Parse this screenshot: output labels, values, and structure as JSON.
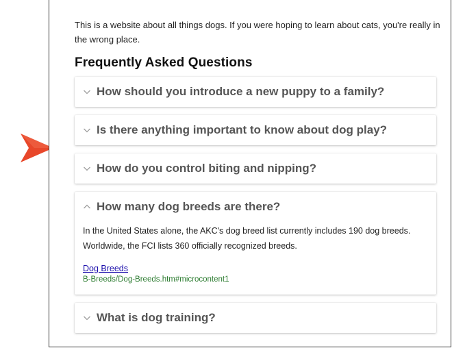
{
  "intro": "This is a website about all things dogs. If you were hoping to learn about cats, you're really in the wrong place.",
  "faq": {
    "heading": "Frequently Asked Questions",
    "items": [
      {
        "question": "How should you introduce a new puppy to a family?",
        "expanded": false
      },
      {
        "question": "Is there anything important to know about dog play?",
        "expanded": false
      },
      {
        "question": "How do you control biting and nipping?",
        "expanded": false
      },
      {
        "question": "How many dog breeds are there?",
        "expanded": true,
        "answer": "In the United States alone, the AKC's dog breed list currently includes 190 dog breeds. Worldwide, the FCI lists 360 officially recognized breeds.",
        "link_label": "Dog Breeds",
        "link_path": "B-Breeds/Dog-Breeds.htm#microcontent1"
      },
      {
        "question": "What is dog training?",
        "expanded": false
      }
    ]
  },
  "colors": {
    "pointer": "#e8472a",
    "question_text": "#555555",
    "link": "#1a0dab",
    "path": "#2e7d32"
  },
  "icons": {
    "pointer": "callout-arrow-icon",
    "collapsed": "chevron-down-icon",
    "expanded": "chevron-up-icon"
  }
}
